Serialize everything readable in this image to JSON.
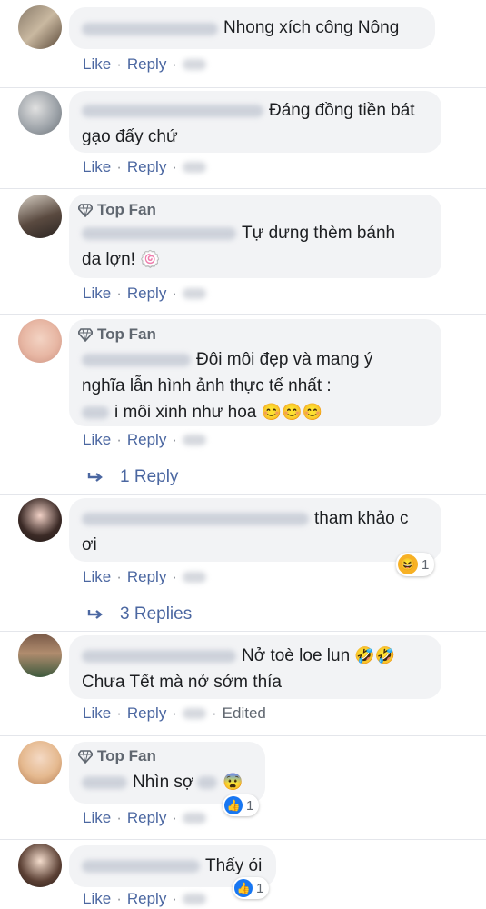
{
  "comments": [
    {
      "text": "Nhong xích công Nông",
      "actions": {
        "like": "Like",
        "reply": "Reply"
      }
    },
    {
      "text1": "Đáng đồng tiền bát",
      "text2": "gạo đấy chứ",
      "actions": {
        "like": "Like",
        "reply": "Reply"
      }
    },
    {
      "badge": "Top Fan",
      "text1": "Tự dưng thèm bánh",
      "text2": "da lợn! ",
      "emoji": "🍥",
      "actions": {
        "like": "Like",
        "reply": "Reply"
      }
    },
    {
      "badge": "Top Fan",
      "text1": "Đôi môi đẹp và mang ý",
      "text2": "nghĩa lẫn hình ảnh thực tế nhất :",
      "text3": "i môi xinh như hoa ",
      "emoji": "😊😊😊",
      "actions": {
        "like": "Like",
        "reply": "Reply"
      },
      "replies": "1 Reply"
    },
    {
      "text1": "tham khảo c",
      "text2": "ơi",
      "reaction": {
        "emoji": "😆",
        "count": "1"
      },
      "actions": {
        "like": "Like",
        "reply": "Reply"
      },
      "replies": "3 Replies"
    },
    {
      "text1": "Nở toè loe lun ",
      "emoji1": "🤣🤣",
      "text2": "Chưa Tết mà nở sớm thía",
      "actions": {
        "like": "Like",
        "reply": "Reply",
        "edited": "Edited"
      }
    },
    {
      "badge": "Top Fan",
      "text": "Nhìn sợ",
      "emoji": "😨",
      "reaction": {
        "emoji": "👍",
        "count": "1"
      },
      "actions": {
        "like": "Like",
        "reply": "Reply"
      }
    },
    {
      "text": "Thấy ói",
      "reaction": {
        "emoji": "👍",
        "count": "1"
      },
      "actions": {
        "like": "Like",
        "reply": "Reply"
      }
    }
  ]
}
